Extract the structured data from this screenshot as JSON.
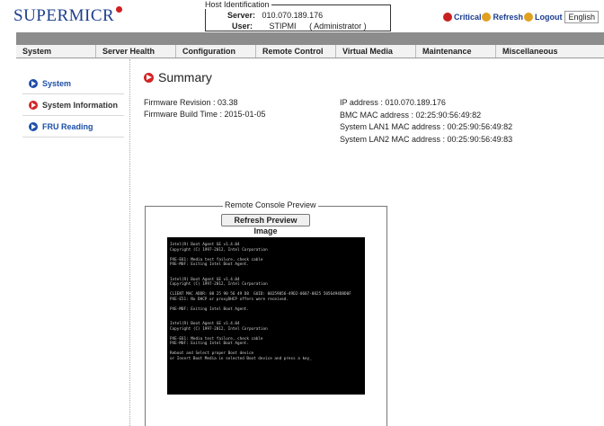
{
  "header": {
    "logo": "SUPERMICR",
    "host_title": "Host Identification",
    "server_label": "Server:",
    "server_value": "010.070.189.176",
    "user_label": "User:",
    "user_value": "STIPMI",
    "user_role": "( Administrator )",
    "critical_label": "Critical",
    "refresh_label": "Refresh",
    "logout_label": "Logout",
    "language": "English"
  },
  "nav": [
    "System",
    "Server Health",
    "Configuration",
    "Remote Control",
    "Virtual Media",
    "Maintenance",
    "Miscellaneous"
  ],
  "sidebar": [
    {
      "label": "System"
    },
    {
      "label": "System Information"
    },
    {
      "label": "FRU Reading"
    }
  ],
  "summary": {
    "title": "Summary",
    "firmware_revision": "Firmware Revision : 03.38",
    "firmware_build_time": "Firmware Build Time : 2015-01-05",
    "ip_address": "IP address : 010.070.189.176",
    "bmc_mac": "BMC MAC address : 02:25:90:56:49:82",
    "lan1_mac": "System LAN1 MAC address : 00:25:90:56:49:82",
    "lan2_mac": "System LAN2 MAC address : 00:25:90:56:49:83"
  },
  "preview": {
    "legend": "Remote Console Preview",
    "refresh_button": "Refresh Preview Image",
    "console_lines": [
      "Intel(R) Boot Agent GE v1.4.04",
      "Copyright (C) 1997-2012, Intel Corporation",
      "",
      "PXE-E61: Media test failure, check cable",
      "PXE-M0F: Exiting Intel Boot Agent.",
      "",
      "",
      "Intel(R) Boot Agent GE v1.4.04",
      "Copyright (C) 1997-2012, Intel Corporation",
      "",
      "CLIENT MAC ADDR: 00 25 90 56 49 D8  GUID: 00259056-49D2-0607-0825 5056494D8D0F",
      "PXE-E51: No DHCP or proxyDHCP offers were received.",
      "",
      "PXE-M0F: Exiting Intel Boot Agent.",
      "",
      "",
      "Intel(R) Boot Agent GE v1.4.04",
      "Copyright (C) 1997-2012, Intel Corporation",
      "",
      "PXE-E61: Media test failure, check cable",
      "PXE-M0F: Exiting Intel Boot Agent.",
      "",
      "Reboot and Select proper Boot device",
      "or Insert Boot Media in selected Boot device and press a key_"
    ]
  }
}
